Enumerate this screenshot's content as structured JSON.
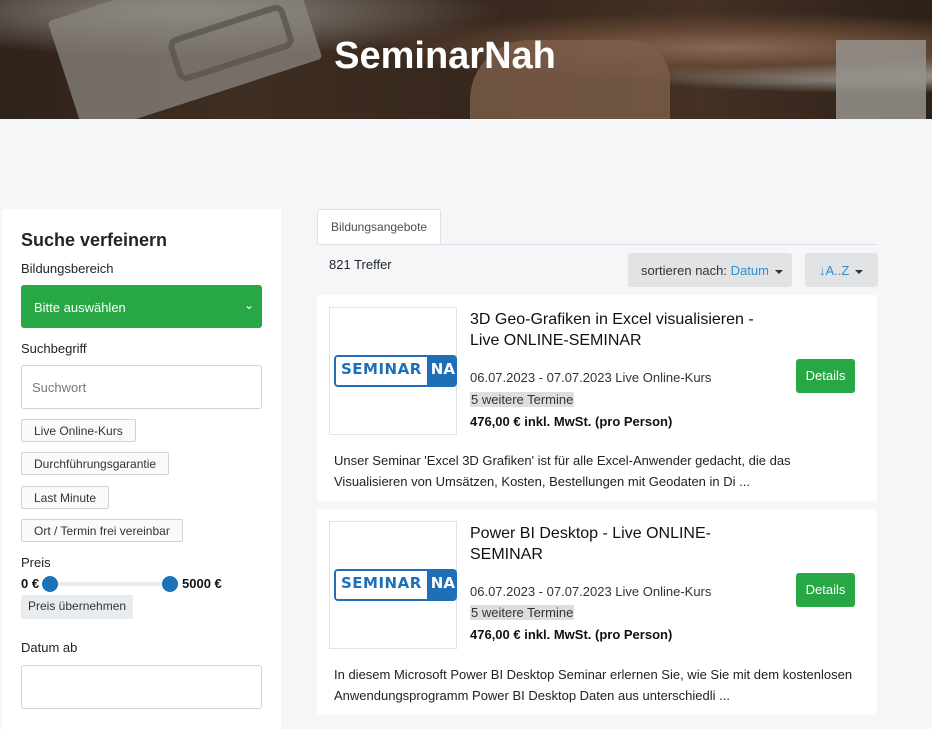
{
  "header": {
    "title": "SeminarNah"
  },
  "sidebar": {
    "heading": "Suche verfeinern",
    "bereich_label": "Bildungsbereich",
    "bereich_value": "Bitte auswählen",
    "suchbegriff_label": "Suchbegriff",
    "suchwort_placeholder": "Suchwort",
    "filters": [
      "Live Online-Kurs",
      "Durchführungsgarantie",
      "Last Minute",
      "Ort / Termin frei vereinbar"
    ],
    "preis_label": "Preis",
    "preis_min": "0 €",
    "preis_max": "5000 €",
    "preis_apply": "Preis übernehmen",
    "datum_label": "Datum ab"
  },
  "main": {
    "tab": "Bildungsangebote",
    "count": "821 Treffer",
    "sort_prefix": "sortieren nach:",
    "sort_value": "Datum",
    "order_label": "A..Z",
    "logo": {
      "part1": "SEMINAR",
      "part2": "NAH"
    },
    "cards": [
      {
        "title": "3D Geo-Grafiken in Excel visualisieren - Live ONLINE-SEMINAR",
        "dates": "06.07.2023 - 07.07.2023 Live Online-Kurs",
        "more": "5 weitere Termine",
        "price": "476,00 € inkl. MwSt. (pro Person)",
        "details": "Details",
        "desc": "Unser Seminar 'Excel 3D Grafiken' ist für alle Excel-Anwender gedacht, die das Visualisieren von Umsätzen, Kosten, Bestellungen mit Geodaten in Di ..."
      },
      {
        "title": "Power BI Desktop - Live ONLINE-SEMINAR",
        "dates": "06.07.2023 - 07.07.2023 Live Online-Kurs",
        "more": "5 weitere Termine",
        "price": "476,00 € inkl. MwSt. (pro Person)",
        "details": "Details",
        "desc": "In diesem Microsoft Power BI Desktop Seminar erlernen Sie, wie Sie mit dem kostenlosen Anwendungsprogramm Power BI Desktop Daten aus unterschiedli ..."
      }
    ]
  },
  "colors": {
    "green": "#28a745",
    "blue": "#1e6fb8",
    "accent": "#2e8fd0"
  }
}
